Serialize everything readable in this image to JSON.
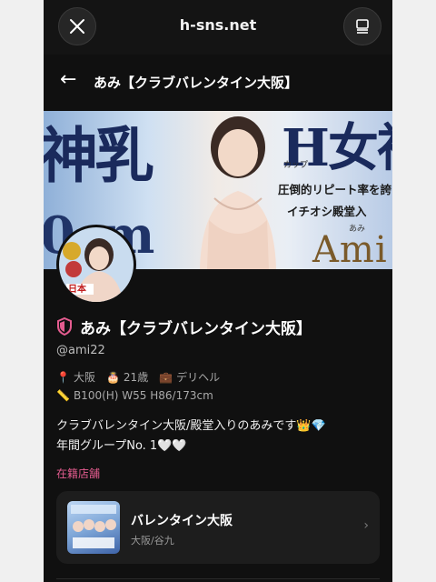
{
  "browser": {
    "domain": "h-sns.net"
  },
  "header": {
    "back_icon": "←",
    "title": "あみ【クラブバレンタイン大阪】"
  },
  "banner": {
    "left_text": "神乳",
    "left_sub": "0cm",
    "right_h": "H女神",
    "cup_label": "カップ",
    "line1": "圧倒的リピート率を誇る",
    "line2": "イチオシ殿堂入",
    "ami_small": "あみ",
    "ami_big": "Ami"
  },
  "avatar": {
    "badge_text": "日本"
  },
  "profile": {
    "name": "あみ【クラブバレンタイン大阪】",
    "handle": "@ami22",
    "location": "大阪",
    "age": "21歳",
    "category": "デリヘル",
    "body": "B100(H) W55 H86/173cm",
    "bio_line1": "クラブバレンタイン大阪/殿堂入りのあみです👑💎",
    "bio_line2": "年間グループNo. 1🤍🤍",
    "accent_color": "#e45c8f"
  },
  "store_section": {
    "label": "在籍店舗"
  },
  "store": {
    "name": "バレンタイン大阪",
    "location": "大阪/谷九"
  }
}
